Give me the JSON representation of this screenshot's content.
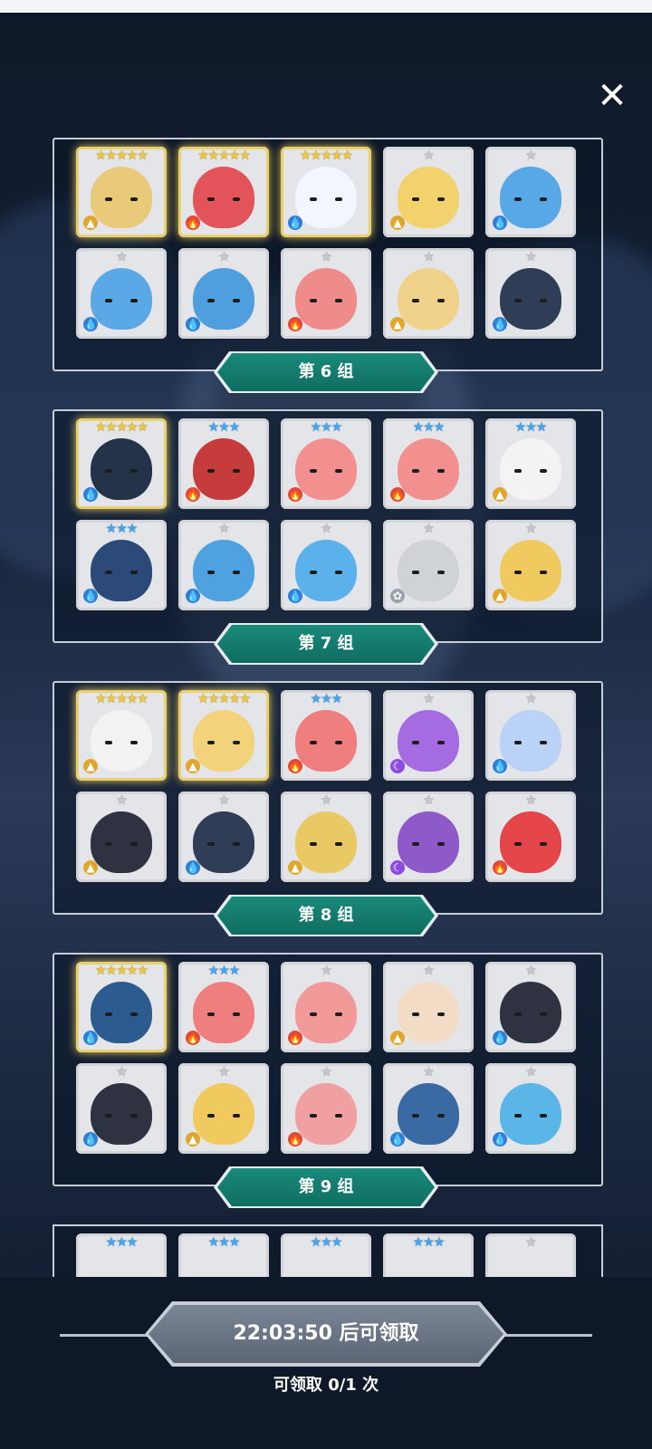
{
  "close_icon_glyph": "✕",
  "groups": [
    {
      "label": "第 6 组",
      "cards": [
        {
          "stars": "★★★★★",
          "tier": "gold",
          "element": "earth",
          "color": "#e9c97a"
        },
        {
          "stars": "★★★★★",
          "tier": "gold",
          "element": "fire",
          "color": "#e2545a"
        },
        {
          "stars": "★★★★★",
          "tier": "gold",
          "element": "water",
          "color": "#f2f6ff"
        },
        {
          "stars": "★",
          "tier": "gray",
          "element": "earth",
          "color": "#f2d26c"
        },
        {
          "stars": "★",
          "tier": "gray",
          "element": "water",
          "color": "#58a7e6"
        },
        {
          "stars": "★",
          "tier": "gray",
          "element": "water",
          "color": "#5aa8e6"
        },
        {
          "stars": "★",
          "tier": "gray",
          "element": "water",
          "color": "#4f9fde"
        },
        {
          "stars": "★",
          "tier": "gray",
          "element": "fire",
          "color": "#f08b8b"
        },
        {
          "stars": "★",
          "tier": "gray",
          "element": "earth",
          "color": "#f0d28a"
        },
        {
          "stars": "★",
          "tier": "gray",
          "element": "water",
          "color": "#2f3d56"
        }
      ]
    },
    {
      "label": "第 7 组",
      "cards": [
        {
          "stars": "★★★★★",
          "tier": "gold",
          "element": "water",
          "color": "#24324a"
        },
        {
          "stars": "★★★",
          "tier": "blue",
          "element": "fire",
          "color": "#c63b3b"
        },
        {
          "stars": "★★★",
          "tier": "blue",
          "element": "fire",
          "color": "#f29090"
        },
        {
          "stars": "★★★",
          "tier": "blue",
          "element": "fire",
          "color": "#f29090"
        },
        {
          "stars": "★★★",
          "tier": "blue",
          "element": "earth",
          "color": "#f3f3f3"
        },
        {
          "stars": "★★★",
          "tier": "blue",
          "element": "water",
          "color": "#2b4a7a"
        },
        {
          "stars": "★",
          "tier": "gray",
          "element": "water",
          "color": "#4ea2e0"
        },
        {
          "stars": "★",
          "tier": "gray",
          "element": "water",
          "color": "#5bb2ea"
        },
        {
          "stars": "★",
          "tier": "gray",
          "element": "light",
          "color": "#cfd3d8"
        },
        {
          "stars": "★",
          "tier": "gray",
          "element": "earth",
          "color": "#f0c95f"
        }
      ]
    },
    {
      "label": "第 8 组",
      "cards": [
        {
          "stars": "★★★★★",
          "tier": "gold",
          "element": "earth",
          "color": "#f2f2f2"
        },
        {
          "stars": "★★★★★",
          "tier": "gold",
          "element": "earth",
          "color": "#f2d27a"
        },
        {
          "stars": "★★★",
          "tier": "blue",
          "element": "fire",
          "color": "#ef7e7e"
        },
        {
          "stars": "★",
          "tier": "gray",
          "element": "dark",
          "color": "#a56be0"
        },
        {
          "stars": "★",
          "tier": "gray",
          "element": "water",
          "color": "#b9d2f5"
        },
        {
          "stars": "★",
          "tier": "gray",
          "element": "earth",
          "color": "#2f3341"
        },
        {
          "stars": "★",
          "tier": "gray",
          "element": "water",
          "color": "#2f3d56"
        },
        {
          "stars": "★",
          "tier": "gray",
          "element": "earth",
          "color": "#e8c963"
        },
        {
          "stars": "★",
          "tier": "gray",
          "element": "dark",
          "color": "#8e59c9"
        },
        {
          "stars": "★",
          "tier": "gray",
          "element": "fire",
          "color": "#e5464a"
        }
      ]
    },
    {
      "label": "第 9 组",
      "cards": [
        {
          "stars": "★★★★★",
          "tier": "gold",
          "element": "water",
          "color": "#2c5b8f"
        },
        {
          "stars": "★★★",
          "tier": "blue",
          "element": "fire",
          "color": "#ef7e7e"
        },
        {
          "stars": "★",
          "tier": "gray",
          "element": "fire",
          "color": "#f29a9a"
        },
        {
          "stars": "★",
          "tier": "gray",
          "element": "earth",
          "color": "#f2dcc6"
        },
        {
          "stars": "★",
          "tier": "gray",
          "element": "water",
          "color": "#2f3341"
        },
        {
          "stars": "★",
          "tier": "gray",
          "element": "water",
          "color": "#2f3341"
        },
        {
          "stars": "★",
          "tier": "gray",
          "element": "earth",
          "color": "#f0c95f"
        },
        {
          "stars": "★",
          "tier": "gray",
          "element": "fire",
          "color": "#f0a0a0"
        },
        {
          "stars": "★",
          "tier": "gray",
          "element": "water",
          "color": "#3a6aa3"
        },
        {
          "stars": "★",
          "tier": "gray",
          "element": "water",
          "color": "#5ab6e6"
        }
      ]
    }
  ],
  "partial_group": {
    "cards": [
      {
        "stars": "★★★",
        "tier": "blue"
      },
      {
        "stars": "★★★",
        "tier": "blue"
      },
      {
        "stars": "★★★",
        "tier": "blue"
      },
      {
        "stars": "★★★",
        "tier": "blue"
      },
      {
        "stars": "★",
        "tier": "gray"
      }
    ]
  },
  "footer": {
    "claim_label": "22:03:50 后可领取",
    "count_label": "可领取 0/1 次"
  },
  "element_colors": {
    "water": "#2f7ed8",
    "fire": "#e0483b",
    "earth": "#e0a72b",
    "dark": "#8d4be0",
    "light": "#9aa3ad"
  },
  "element_glyphs": {
    "water": "💧",
    "fire": "🔥",
    "earth": "▲",
    "dark": "☾",
    "light": "✿"
  }
}
